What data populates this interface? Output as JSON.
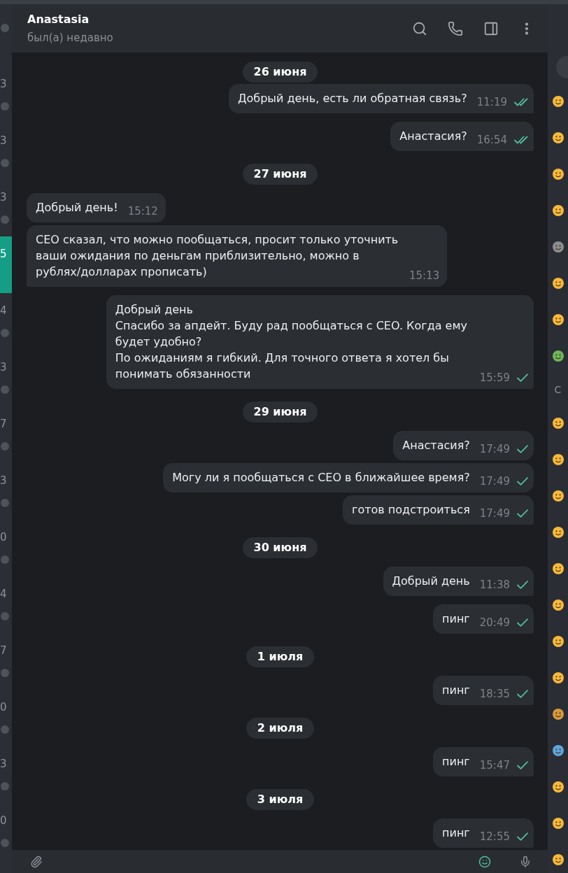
{
  "chat_list": [
    {
      "badge": true,
      "selected": false
    },
    {
      "time": "3",
      "badge": true,
      "selected": false
    },
    {
      "time": "3",
      "badge": true,
      "selected": false
    },
    {
      "time": "3",
      "badge": true,
      "selected": false
    },
    {
      "time": "5",
      "badge": false,
      "selected": true
    },
    {
      "time": "4",
      "badge": true,
      "selected": false
    },
    {
      "time": "3",
      "badge": true,
      "selected": false
    },
    {
      "time": "7",
      "badge": true,
      "selected": false
    },
    {
      "time": "3",
      "badge": true,
      "selected": false
    },
    {
      "time": "0",
      "badge": true,
      "selected": false
    },
    {
      "time": "4",
      "badge": true,
      "selected": false
    },
    {
      "time": "7",
      "badge": true,
      "selected": false
    },
    {
      "time": "0",
      "badge": true,
      "selected": false
    },
    {
      "time": "3",
      "badge": true,
      "selected": false
    },
    {
      "time": "0",
      "badge": true,
      "selected": false
    }
  ],
  "header": {
    "title": "Anastasia",
    "status": "был(а) недавно"
  },
  "days": [
    {
      "date": "26 июня",
      "messages": [
        {
          "kind": "outgoing",
          "text": "Добрый день, есть ли обратная связь?",
          "time": "11:19",
          "read": true,
          "tail": true
        },
        {
          "kind": "outgoing",
          "text": "Анастасия?",
          "time": "16:54",
          "read": true,
          "tail": true
        }
      ]
    },
    {
      "date": "27 июня",
      "messages": [
        {
          "kind": "incoming",
          "text": "Добрый день!",
          "time": "15:12",
          "tail": false
        },
        {
          "kind": "incoming",
          "text": "CEO сказал, что можно пообщаться, просит только уточнить ваши ожидания по деньгам приблизительно, можно в рублях/долларах прописать)",
          "time": "15:13",
          "tail": true
        },
        {
          "kind": "outgoing",
          "text": "Добрый день\nСпасибо за апдейт. Буду рад пообщаться с CEO. Когда ему будет удобно?\nПо ожиданиям я гибкий. Для точного ответа я хотел бы понимать обязанности",
          "time": "15:59",
          "read": false,
          "tail": true
        }
      ]
    },
    {
      "date": "29 июня",
      "messages": [
        {
          "kind": "outgoing",
          "text": "Анастасия?",
          "time": "17:49",
          "read": false,
          "tail": false
        },
        {
          "kind": "outgoing",
          "text": "Могу ли я пообщаться с CEO в ближайшее время?",
          "time": "17:49",
          "read": false,
          "tail": false
        },
        {
          "kind": "outgoing",
          "text": "готов подстроиться",
          "time": "17:49",
          "read": false,
          "tail": true
        }
      ]
    },
    {
      "date": "30 июня",
      "messages": [
        {
          "kind": "outgoing",
          "text": "Добрый день",
          "time": "11:38",
          "read": false,
          "tail": true
        },
        {
          "kind": "outgoing",
          "text": "пинг",
          "time": "20:49",
          "read": false,
          "tail": true
        }
      ]
    },
    {
      "date": "1 июля",
      "messages": [
        {
          "kind": "outgoing",
          "text": "пинг",
          "time": "18:35",
          "read": false,
          "tail": true
        }
      ]
    },
    {
      "date": "2 июля",
      "messages": [
        {
          "kind": "outgoing",
          "text": "пинг",
          "time": "15:47",
          "read": false,
          "tail": true
        }
      ]
    },
    {
      "date": "3 июля",
      "messages": [
        {
          "kind": "outgoing",
          "text": "пинг",
          "time": "12:55",
          "read": false,
          "tail": true
        }
      ]
    }
  ],
  "emoji_panel": {
    "section_label": "С"
  }
}
